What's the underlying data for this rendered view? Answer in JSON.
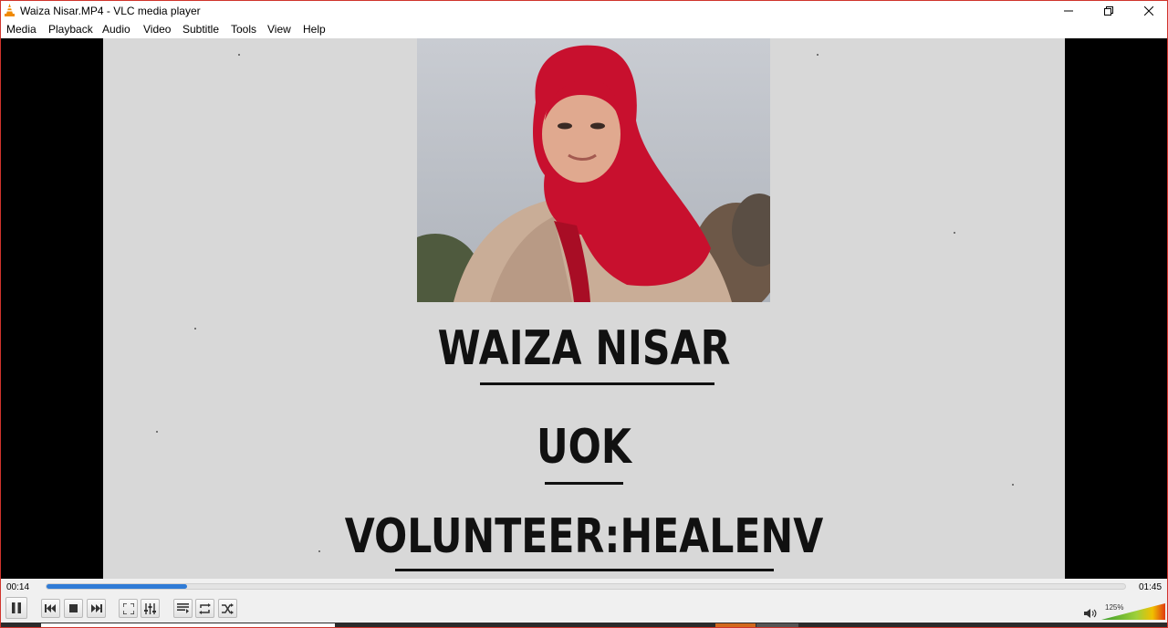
{
  "window": {
    "title": "Waiza Nisar.MP4 - VLC media player",
    "icons": {
      "app": "vlc-cone-icon",
      "minimize": "minimize-icon",
      "restore": "restore-icon",
      "close": "close-icon"
    }
  },
  "menu": {
    "items": [
      "Media",
      "Playback",
      "Audio",
      "Video",
      "Subtitle",
      "Tools",
      "View",
      "Help"
    ]
  },
  "video": {
    "lines": [
      "WAIZA NISAR",
      "UOK",
      "VOLUNTEER:HEALENV"
    ]
  },
  "playback": {
    "elapsed": "00:14",
    "total": "01:45",
    "progress_fraction": 0.13,
    "volume_label": "125%",
    "volume_fraction": 1.0,
    "accent_color": "#2f7bd6"
  },
  "controls": {
    "icons": [
      "pause-icon",
      "previous-icon",
      "stop-icon",
      "next-icon",
      "fullscreen-icon",
      "extended-settings-icon",
      "playlist-icon",
      "loop-icon",
      "shuffle-icon",
      "speaker-icon"
    ]
  }
}
